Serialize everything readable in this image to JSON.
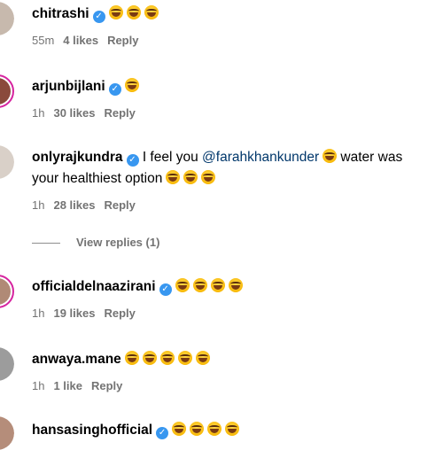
{
  "comments": [
    {
      "username": "chitrashi",
      "verified": true,
      "text": "",
      "emoji_count": 3,
      "time": "55m",
      "likes": "4 likes",
      "reply": "Reply",
      "avatar_color": "#c7b9ad"
    },
    {
      "username": "arjunbijlani",
      "verified": true,
      "text": "",
      "emoji_count": 1,
      "time": "1h",
      "likes": "30 likes",
      "reply": "Reply",
      "avatar_color": "#8a4a3c"
    },
    {
      "username": "onlyrajkundra",
      "verified": true,
      "text_before": "I feel you",
      "mention": "@farahkhankunder",
      "text_after": "water was",
      "text_line2": "your healthiest option",
      "emoji_count": 3,
      "time": "1h",
      "likes": "28 likes",
      "reply": "Reply",
      "avatar_color": "#d9d0c8"
    },
    {
      "username": "officialdelnaazirani",
      "verified": true,
      "text": "",
      "emoji_count": 4,
      "time": "1h",
      "likes": "19 likes",
      "reply": "Reply",
      "avatar_color": "#b08a76"
    },
    {
      "username": "anwaya.mane",
      "verified": false,
      "text": "",
      "emoji_count": 5,
      "time": "1h",
      "likes": "1 like",
      "reply": "Reply",
      "avatar_color": "#9c9c9c"
    },
    {
      "username": "hansasinghofficial",
      "verified": true,
      "text": "",
      "emoji_count": 4,
      "avatar_color": "#b58d7a"
    }
  ],
  "view_replies": "View replies (1)",
  "colors": {
    "verified": "#3897f0",
    "mention": "#00376b",
    "meta": "#737373",
    "ring": "#d6249f"
  }
}
